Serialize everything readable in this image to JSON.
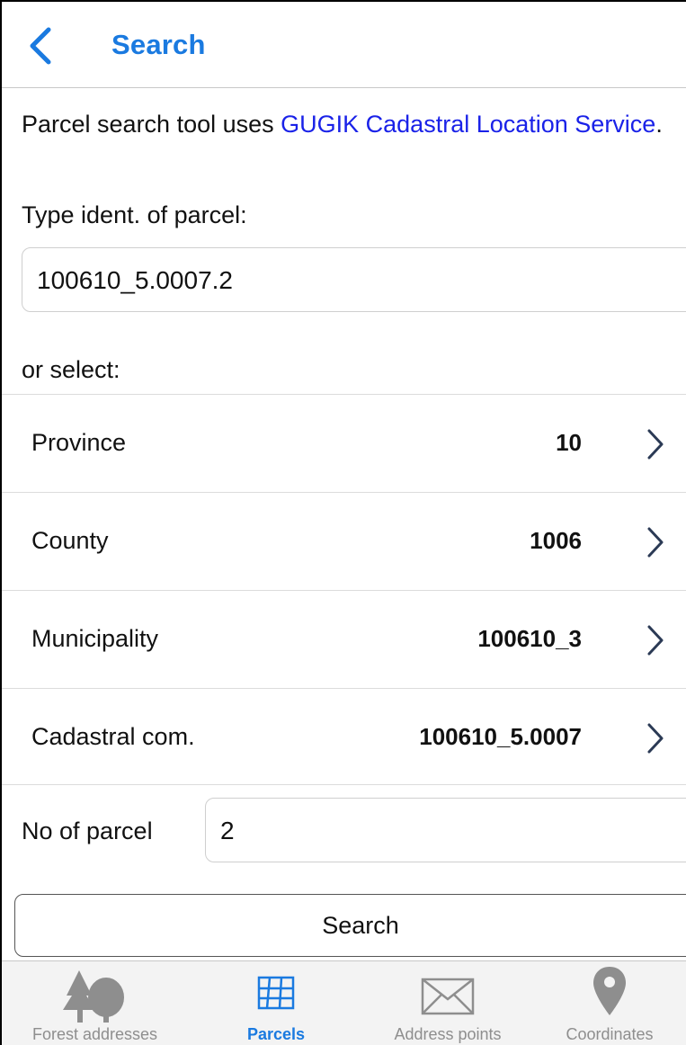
{
  "header": {
    "title": "Search"
  },
  "intro": {
    "prefix": "Parcel search tool uses ",
    "link_text": "GUGIK Cadastral Location Service",
    "suffix": "."
  },
  "ident": {
    "label": "Type ident. of parcel:",
    "value": "100610_5.0007.2"
  },
  "select_label": "or select:",
  "selects": [
    {
      "label": "Province",
      "value": "10"
    },
    {
      "label": "County",
      "value": "1006"
    },
    {
      "label": "Municipality",
      "value": "100610_3"
    },
    {
      "label": "Cadastral com.",
      "value": "100610_5.0007"
    }
  ],
  "parcel": {
    "label": "No of parcel",
    "value": "2"
  },
  "search_button": "Search",
  "tabs": [
    {
      "label": "Forest addresses",
      "icon": "trees-icon",
      "active": false
    },
    {
      "label": "Parcels",
      "icon": "grid-icon",
      "active": true
    },
    {
      "label": "Address points",
      "icon": "envelope-icon",
      "active": false
    },
    {
      "label": "Coordinates",
      "icon": "map-pin-icon",
      "active": false
    }
  ],
  "colors": {
    "accent": "#1a7ae0",
    "link": "#1a22e8",
    "inactive_tab": "#8e8e8e"
  }
}
